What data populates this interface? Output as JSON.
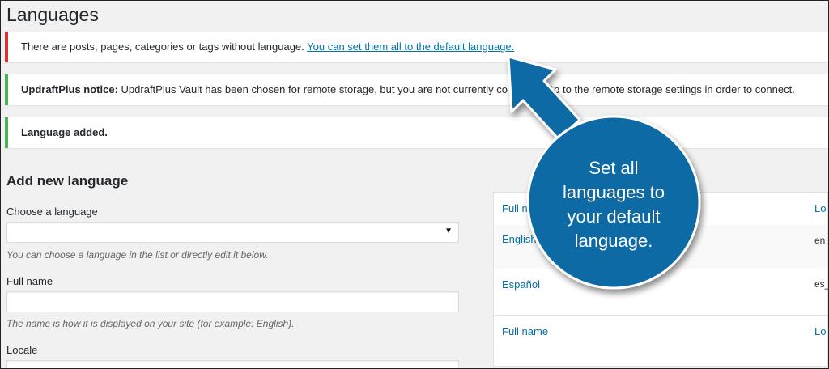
{
  "page": {
    "title": "Languages"
  },
  "notices": {
    "no_language_text": "There are posts, pages, categories or tags without language.",
    "no_language_link": "You can set them all to the default language.",
    "updraft_label": "UpdraftPlus notice:",
    "updraft_text": "UpdraftPlus Vault has been chosen for remote storage, but you are not currently co",
    "updraft_text_tail": "Go to the remote storage settings in order to connect.",
    "language_added": "Language added."
  },
  "form": {
    "title": "Add new language",
    "choose_label": "Choose a language",
    "choose_value": "",
    "choose_desc": "You can choose a language in the list or directly edit it below.",
    "fullname_label": "Full name",
    "fullname_value": "",
    "fullname_desc": "The name is how it is displayed on your site (for example: English).",
    "locale_label": "Locale"
  },
  "table": {
    "header": {
      "full_name": "Full n",
      "locale": "Lo"
    },
    "rows": [
      {
        "full_name": "English",
        "locale": "en"
      },
      {
        "full_name": "Español",
        "locale": "es_"
      }
    ],
    "footer": {
      "full_name": "Full name",
      "locale": "Lo"
    }
  },
  "callout": {
    "line1": "Set all",
    "line2": "languages to",
    "line3": "your default",
    "line4": "language.",
    "color": "#0c6aa4"
  },
  "colors": {
    "link": "#0073aa",
    "error_border": "#dc3232",
    "success_border": "#46b450"
  }
}
